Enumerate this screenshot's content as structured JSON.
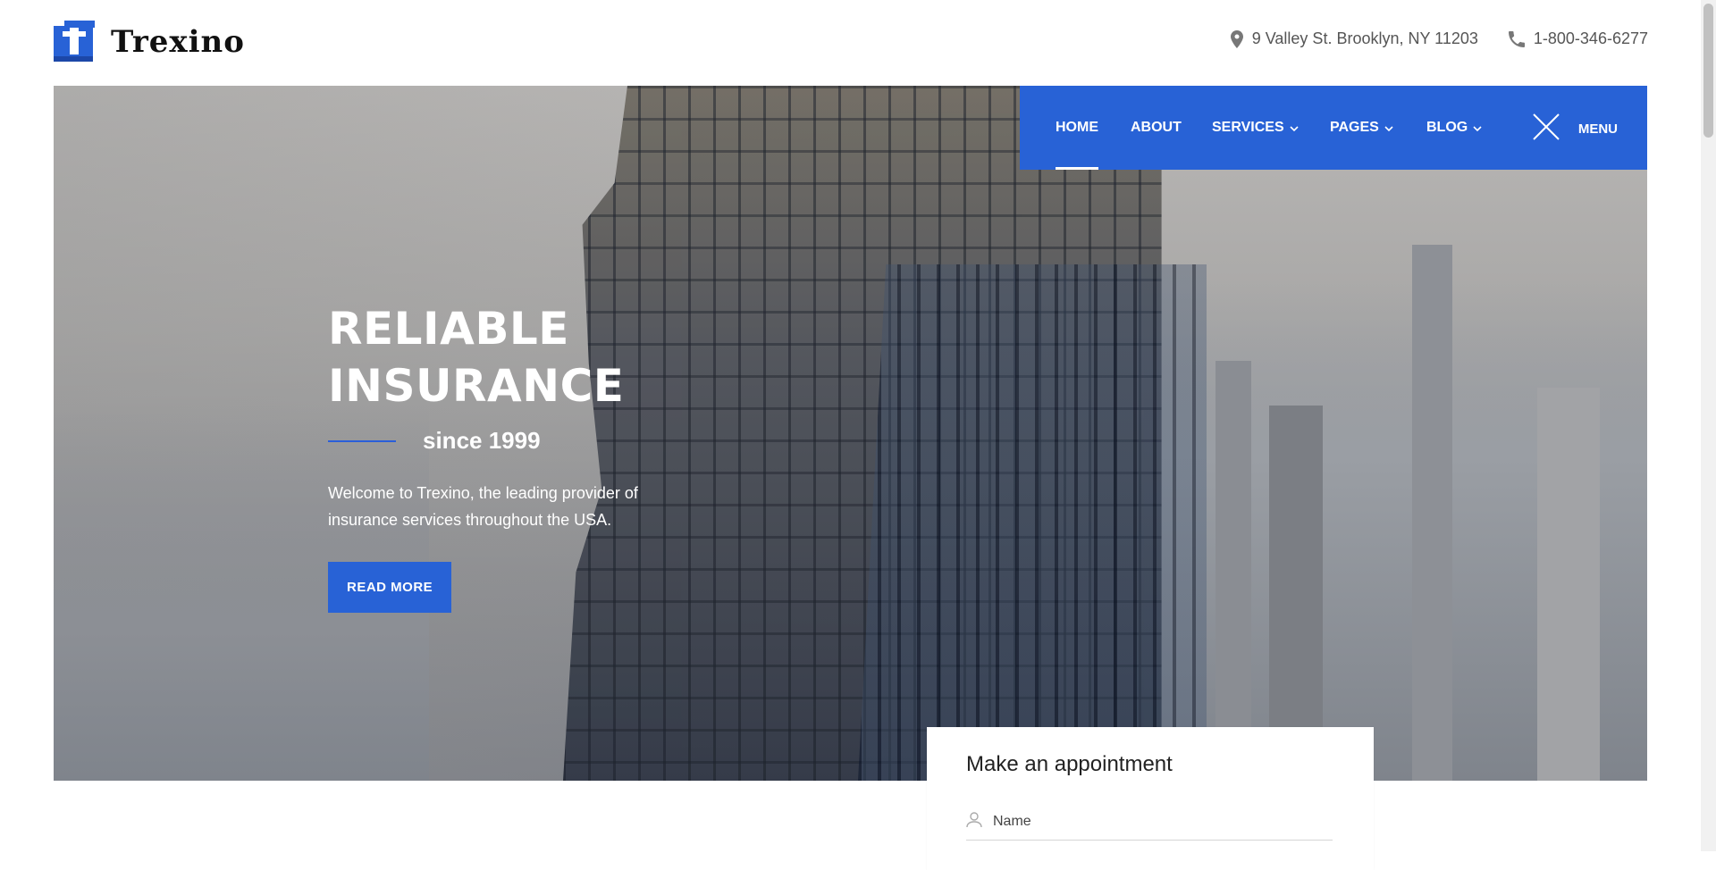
{
  "brand": {
    "name": "Trexino",
    "accent": "#2862d6"
  },
  "contact": {
    "address": "9 Valley St. Brooklyn, NY 11203",
    "phone": "1-800-346-6277",
    "address_icon": "map-pin-icon",
    "phone_icon": "phone-icon"
  },
  "nav": {
    "items": [
      {
        "label": "HOME",
        "active": true,
        "has_dropdown": false
      },
      {
        "label": "ABOUT",
        "active": false,
        "has_dropdown": false
      },
      {
        "label": "SERVICES",
        "active": false,
        "has_dropdown": true
      },
      {
        "label": "PAGES",
        "active": false,
        "has_dropdown": true
      },
      {
        "label": "BLOG",
        "active": false,
        "has_dropdown": true
      }
    ],
    "menu_label": "MENU"
  },
  "hero": {
    "title_line1": "RELIABLE",
    "title_line2": "INSURANCE",
    "since": "since 1999",
    "description": "Welcome to Trexino, the leading provider of insurance services throughout the USA.",
    "button_label": "READ MORE"
  },
  "appointment": {
    "title": "Make an appointment",
    "name_placeholder": "Name",
    "name_value": ""
  }
}
